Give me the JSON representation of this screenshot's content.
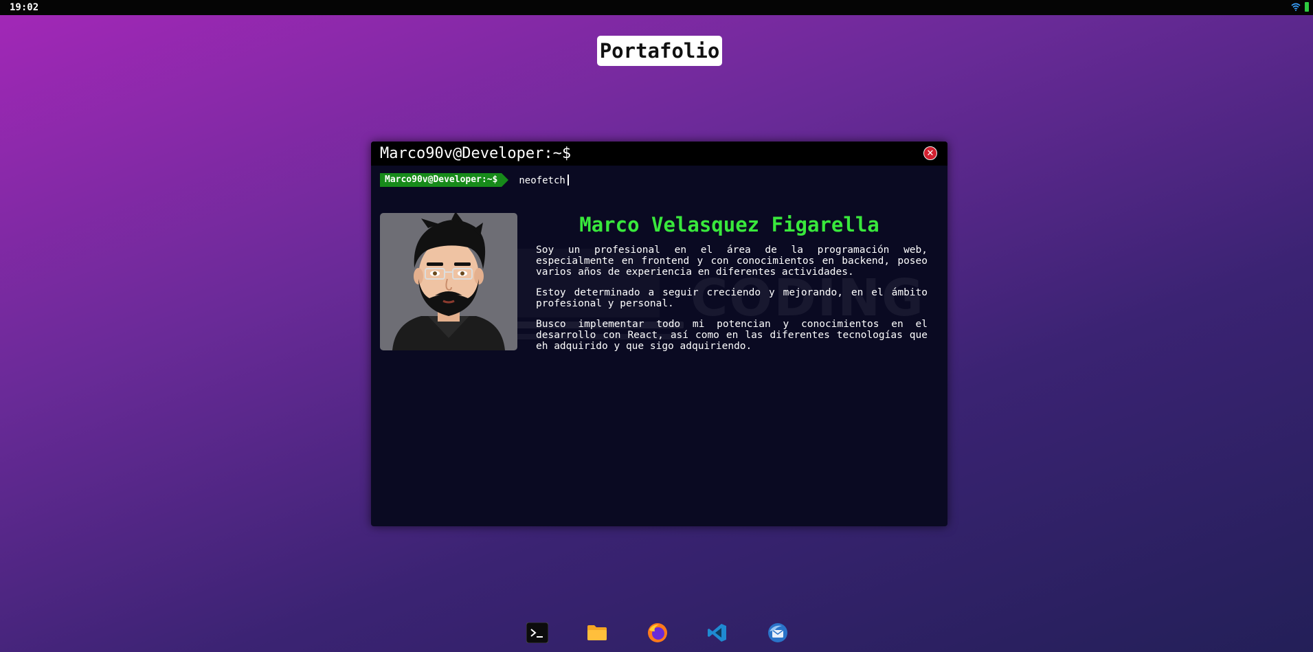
{
  "topbar": {
    "clock": "19:02",
    "icons": [
      "wifi-icon",
      "battery-icon"
    ]
  },
  "page_title": "Portafolio",
  "terminal": {
    "window_title": "Marco90v@Developer:~$",
    "prompt": "Marco90v@Developer:~$",
    "command": "neofetch",
    "close_icon": "close-icon",
    "profile": {
      "name": "Marco Velasquez Figarella",
      "avatar": "avatar-illustration",
      "paragraphs": [
        "Soy un profesional en el área de la programación web, especialmente en frontend y con conocimientos en backend, poseo varios años de experiencia en diferentes actividades.",
        "Estoy determinado a seguir creciendo y mejorando, en el ámbito profesional y personal.",
        "Busco implementar todo mi potencian y conocimientos en el desarrollo con React, así como en las diferentes tecnologías que eh adquirido y que sigo adquiriendo."
      ]
    },
    "background_watermark": "CODING"
  },
  "dock": {
    "items": [
      {
        "name": "terminal",
        "icon": "terminal-icon"
      },
      {
        "name": "files",
        "icon": "folder-icon"
      },
      {
        "name": "firefox",
        "icon": "firefox-icon"
      },
      {
        "name": "vscode",
        "icon": "vscode-icon"
      },
      {
        "name": "thunderbird",
        "icon": "thunderbird-icon"
      }
    ]
  },
  "colors": {
    "prompt_bg": "#178a1a",
    "name_color": "#39e83c",
    "terminal_bg": "#0a0a22",
    "close_button": "#d2202f"
  }
}
